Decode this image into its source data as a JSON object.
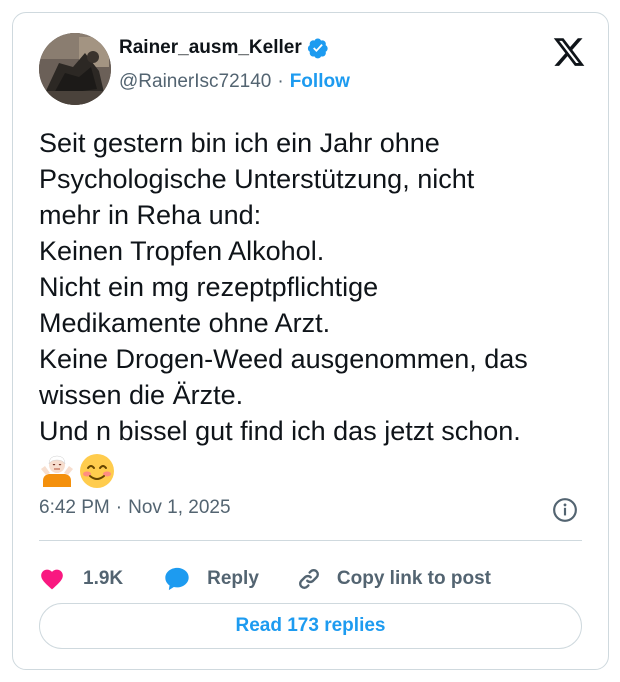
{
  "author": {
    "display_name": "Rainer_ausm_Keller",
    "handle": "@RainerIsc72140",
    "separator": "·",
    "follow_label": "Follow"
  },
  "tweet": {
    "lines": [
      "Seit gestern bin ich ein Jahr ohne",
      "Psychologische Unterstützung, nicht",
      "mehr in Reha und:",
      "Keinen Tropfen Alkohol.",
      "Nicht ein mg rezeptpflichtige",
      "Medikamente ohne Arzt.",
      "Keine Drogen-Weed ausgenommen, das",
      "wissen die Ärzte.",
      "Und n bissel gut find ich das jetzt schon."
    ],
    "emojis": [
      "person-shrugging-emoji",
      "smiling-face-with-smiling-eyes-emoji"
    ]
  },
  "meta": {
    "time": "6:42 PM",
    "separator": "·",
    "date": "Nov 1, 2025"
  },
  "actions": {
    "like_count": "1.9K",
    "reply_label": "Reply",
    "copy_label": "Copy link to post"
  },
  "read_replies_label": "Read 173 replies",
  "colors": {
    "accent": "#1d9bf0",
    "like": "#f91880",
    "muted": "#536471",
    "text": "#0f1419",
    "border": "#cfd9de"
  },
  "icons": [
    "verified-badge-icon",
    "x-logo-icon",
    "info-icon",
    "heart-icon",
    "reply-bubble-icon",
    "link-icon"
  ]
}
